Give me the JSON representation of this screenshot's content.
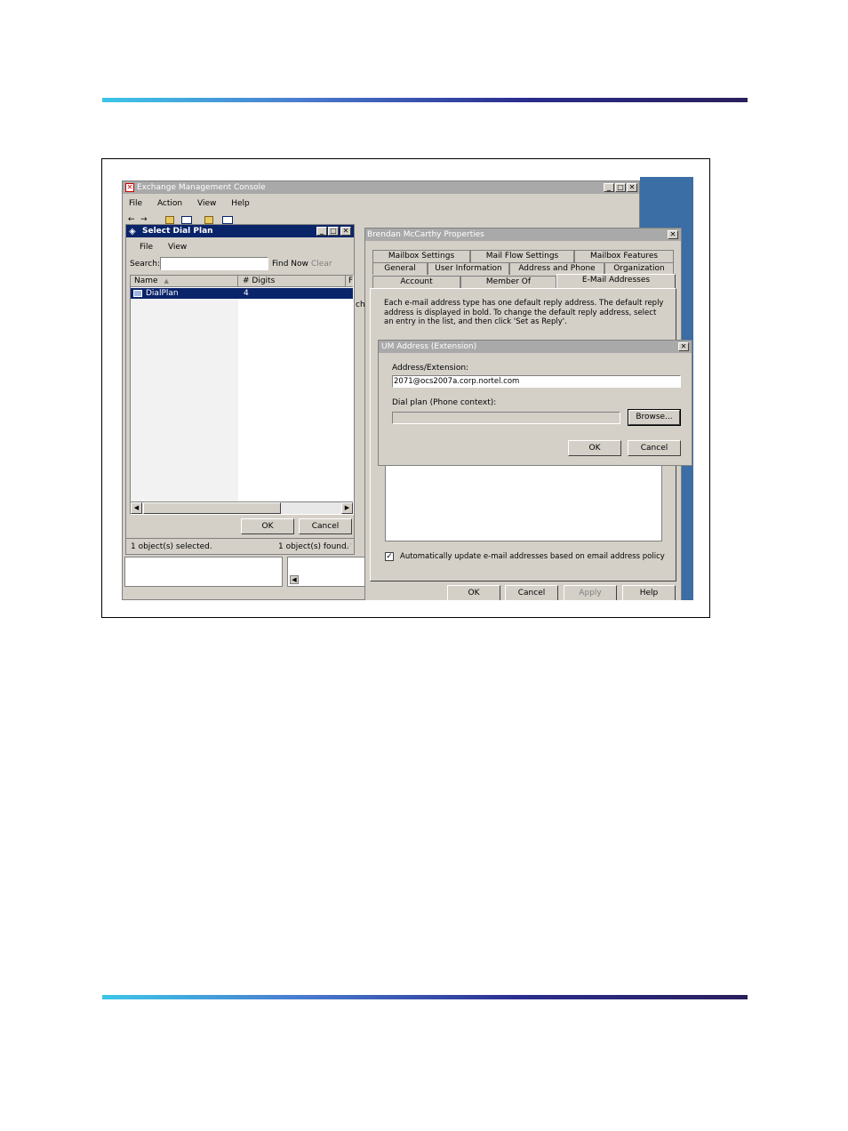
{
  "emc": {
    "title": "Exchange Management Console",
    "menu": [
      "File",
      "Action",
      "View",
      "Help"
    ]
  },
  "dial_plan_window": {
    "title": "Select Dial Plan",
    "menu": [
      "File",
      "View"
    ],
    "search_label": "Search:",
    "search_value": "",
    "find_now": "Find Now",
    "clear": "Clear",
    "columns": [
      "Name",
      "# Digits",
      "F"
    ],
    "rows": [
      {
        "name": "DialPlan",
        "digits": "4"
      }
    ],
    "ok": "OK",
    "cancel": "Cancel",
    "status_selected": "1 object(s) selected.",
    "status_found": "1 object(s) found."
  },
  "properties_window": {
    "title": "Brendan  McCarthy Properties",
    "tabs_row1": [
      "Mailbox Settings",
      "Mail Flow Settings",
      "Mailbox Features"
    ],
    "tabs_row2": [
      "General",
      "User Information",
      "Address and Phone",
      "Organization"
    ],
    "tabs_row3": [
      "Account",
      "Member Of",
      "E-Mail Addresses"
    ],
    "active_tab": "E-Mail Addresses",
    "description": "Each e-mail address type has one default reply address. The default reply address is displayed in bold. To change the default reply address, select an entry in the list, and then click 'Set as Reply'.",
    "auto_update_label": "Automatically update e-mail addresses based on email address policy",
    "auto_update_checked": true,
    "ok": "OK",
    "cancel": "Cancel",
    "apply": "Apply",
    "help": "Help"
  },
  "um_dialog": {
    "title": "UM Address (Extension)",
    "address_label": "Address/Extension:",
    "address_value": "2071@ocs2007a.corp.nortel.com",
    "dialplan_label": "Dial plan (Phone context):",
    "dialplan_value": "",
    "browse": "Browse...",
    "ok": "OK",
    "cancel": "Cancel"
  },
  "colors": {
    "desktop": "#3a6ea5",
    "window_face": "#d4d0c8",
    "active_title": "#0a246a",
    "inactive_title": "#a9a9a9",
    "selection": "#0a246a"
  }
}
